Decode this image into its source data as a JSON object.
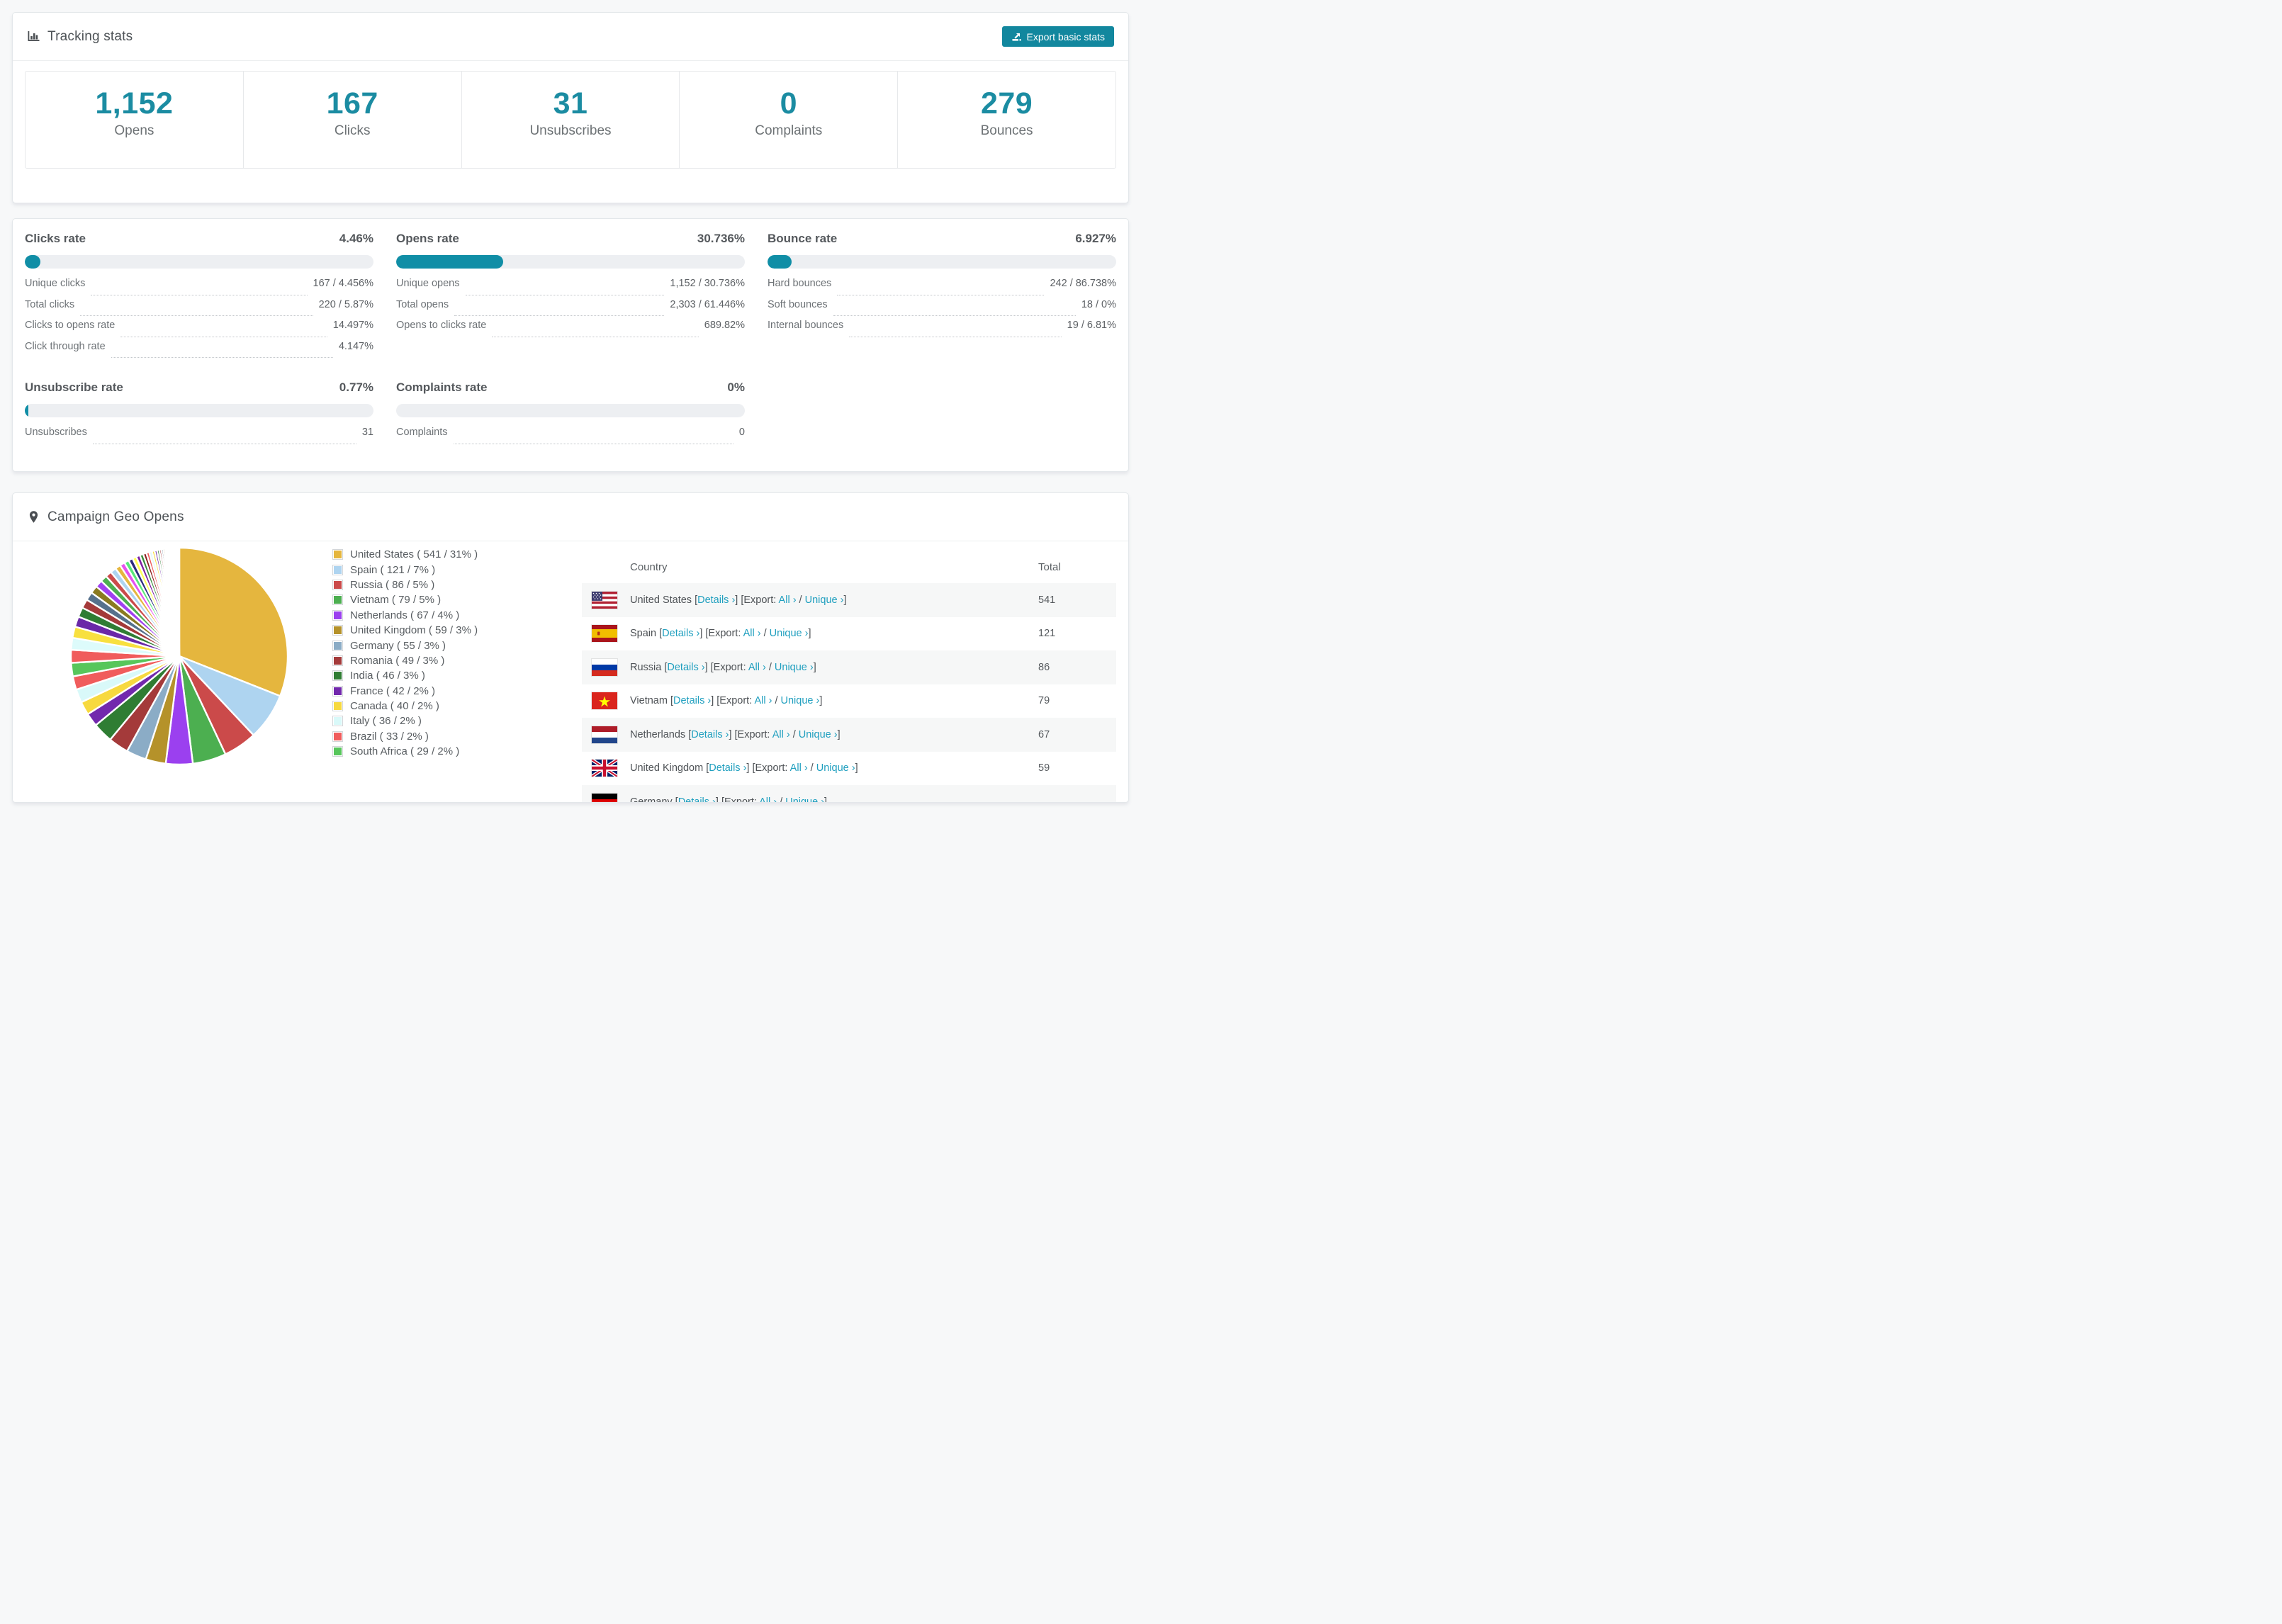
{
  "accent": {
    "teal": "#108ea6",
    "number_teal": "#1b8ca2",
    "link_teal": "#1f9fbf",
    "button_teal": "#12879e"
  },
  "header": {
    "title": "Tracking stats",
    "icon": "bar-chart-icon",
    "export_button": "Export basic stats",
    "export_icon": "export-arrow-icon"
  },
  "summary_stats": [
    {
      "value": "1,152",
      "label": "Opens"
    },
    {
      "value": "167",
      "label": "Clicks"
    },
    {
      "value": "31",
      "label": "Unsubscribes"
    },
    {
      "value": "0",
      "label": "Complaints"
    },
    {
      "value": "279",
      "label": "Bounces"
    }
  ],
  "rates": {
    "columns": [
      {
        "title": "Clicks rate",
        "value": "4.46%",
        "percent": 4.46,
        "rows": [
          {
            "label": "Unique clicks",
            "value": "167 / 4.456%"
          },
          {
            "label": "Total clicks",
            "value": "220 / 5.87%"
          },
          {
            "label": "Clicks to opens rate",
            "value": "14.497%"
          },
          {
            "label": "Click through rate",
            "value": "4.147%"
          }
        ]
      },
      {
        "title": "Opens rate",
        "value": "30.736%",
        "percent": 30.736,
        "rows": [
          {
            "label": "Unique opens",
            "value": "1,152 / 30.736%"
          },
          {
            "label": "Total opens",
            "value": "2,303 / 61.446%"
          },
          {
            "label": "Opens to clicks rate",
            "value": "689.82%"
          }
        ]
      },
      {
        "title": "Bounce rate",
        "value": "6.927%",
        "percent": 6.927,
        "rows": [
          {
            "label": "Hard bounces",
            "value": "242 / 86.738%"
          },
          {
            "label": "Soft bounces",
            "value": "18 / 0%"
          },
          {
            "label": "Internal bounces",
            "value": "19 / 6.81%"
          }
        ]
      },
      {
        "title": "Unsubscribe rate",
        "value": "0.77%",
        "percent": 0.77,
        "rows": [
          {
            "label": "Unsubscribes",
            "value": "31"
          }
        ]
      },
      {
        "title": "Complaints rate",
        "value": "0%",
        "percent": 0,
        "rows": [
          {
            "label": "Complaints",
            "value": "0"
          }
        ]
      }
    ]
  },
  "geo": {
    "title": "Campaign Geo Opens",
    "icon": "map-pin-icon",
    "table": {
      "columns": [
        "Country",
        "Total"
      ],
      "links": {
        "details": "Details",
        "export_prefix": "Export:",
        "all": "All",
        "unique": "Unique",
        "chevron": "›"
      },
      "rows": [
        {
          "flag": "us",
          "country": "United States",
          "total": "541"
        },
        {
          "flag": "es",
          "country": "Spain",
          "total": "121"
        },
        {
          "flag": "ru",
          "country": "Russia",
          "total": "86"
        },
        {
          "flag": "vn",
          "country": "Vietnam",
          "total": "79"
        },
        {
          "flag": "nl",
          "country": "Netherlands",
          "total": "67"
        },
        {
          "flag": "gb",
          "country": "United Kingdom",
          "total": "59"
        },
        {
          "flag": "de",
          "country": "Germany",
          "total": "",
          "partial": true
        }
      ]
    }
  },
  "chart_data": {
    "type": "pie",
    "title": "Campaign Geo Opens",
    "legend_position": "right",
    "start_angle_deg": 0,
    "direction": "clockwise",
    "labels": [
      "United States",
      "Spain",
      "Russia",
      "Vietnam",
      "Netherlands",
      "United Kingdom",
      "Germany",
      "Romania",
      "India",
      "France",
      "Canada",
      "Italy",
      "Brazil",
      "South Africa"
    ],
    "opens": [
      541,
      121,
      86,
      79,
      67,
      59,
      55,
      49,
      46,
      42,
      40,
      36,
      33,
      29
    ],
    "percent": [
      31,
      7,
      5,
      5,
      4,
      3,
      3,
      3,
      3,
      2,
      2,
      2,
      2,
      2
    ],
    "colors": [
      "#E5B63E",
      "#AED4F0",
      "#CB4A4A",
      "#4CAF50",
      "#9B40EF",
      "#B5922A",
      "#8BACC6",
      "#A43A3A",
      "#2F7D33",
      "#7228AD",
      "#F7D93F",
      "#D9F9F9",
      "#F05C5C",
      "#57C65B"
    ],
    "others_percent_total": 26,
    "legend_format": "{label} ( {opens} / {percent}% )"
  }
}
